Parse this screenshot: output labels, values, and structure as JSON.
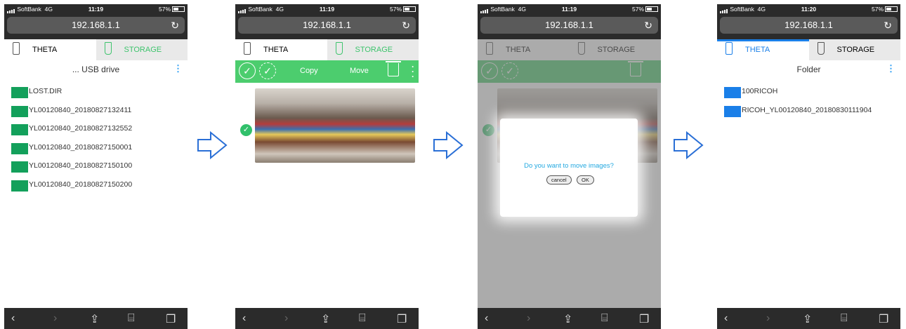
{
  "status": {
    "carrier": "SoftBank",
    "network": "4G",
    "battery": "57%"
  },
  "times": [
    "11:19",
    "11:19",
    "11:19",
    "11:20"
  ],
  "url": "192.168.1.1",
  "tabs": {
    "theta": "THETA",
    "storage": "STORAGE"
  },
  "phone1": {
    "subtitle": "... USB drive",
    "folders": [
      "LOST.DIR",
      "YL00120840_20180827132411",
      "YL00120840_20180827132552",
      "YL00120840_20180827150001",
      "YL00120840_20180827150100",
      "YL00120840_20180827150200"
    ]
  },
  "phone2": {
    "copy_label": "Copy",
    "move_label": "Move"
  },
  "phone3": {
    "question": "Do you want to move images?",
    "cancel": "cancel",
    "ok": "OK"
  },
  "phone4": {
    "subtitle": "Folder",
    "folders": [
      "100RICOH",
      "RICOH_YL00120840_20180830111904"
    ]
  },
  "colors": {
    "green": "#3ec46d",
    "blue": "#1a7fe8",
    "arrow": "#2a6fd6"
  },
  "icons": [
    "signal-icon",
    "battery-icon",
    "reload-icon",
    "theta-camera-icon",
    "usb-drive-icon",
    "folder-icon",
    "kebab-menu-icon",
    "select-all-icon",
    "deselect-icon",
    "trash-icon",
    "check-icon",
    "back-icon",
    "forward-icon",
    "share-icon",
    "bookmarks-icon",
    "tabs-icon",
    "right-arrow-icon"
  ]
}
